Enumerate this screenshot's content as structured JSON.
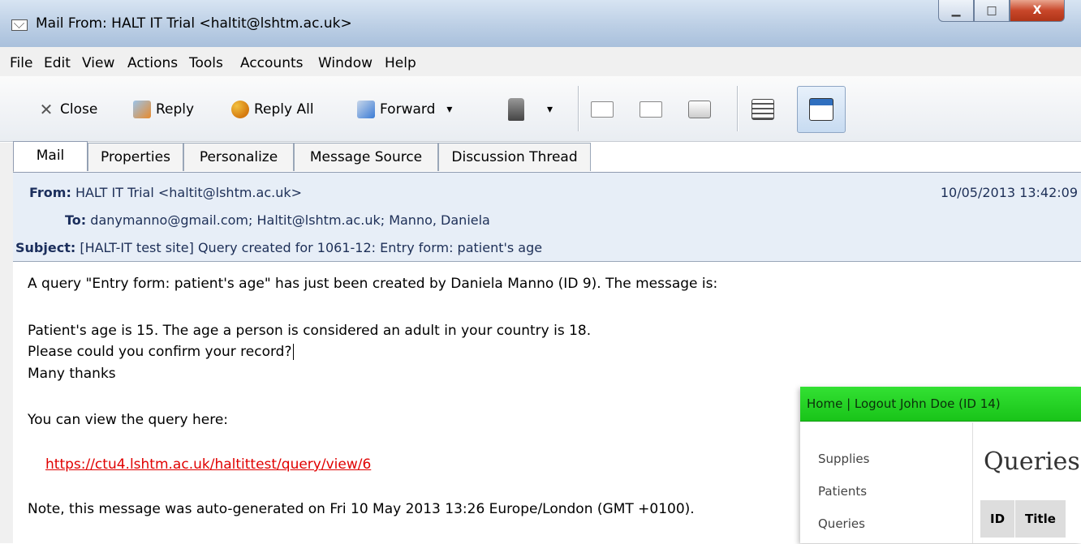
{
  "window": {
    "title": "Mail From: HALT IT Trial <haltit@lshtm.ac.uk>",
    "minimize": "▁",
    "maximize": "□",
    "close": "X"
  },
  "menu": [
    "File",
    "Edit",
    "View",
    "Actions",
    "Tools",
    "Accounts",
    "Window",
    "Help"
  ],
  "toolbar": {
    "close": "Close",
    "reply": "Reply",
    "reply_all": "Reply All",
    "forward": "Forward",
    "dropdown": "▾"
  },
  "tabs": [
    "Mail",
    "Properties",
    "Personalize",
    "Message Source",
    "Discussion Thread"
  ],
  "header": {
    "from_label": "From:",
    "from": "HALT IT Trial <haltit@lshtm.ac.uk>",
    "date": "10/05/2013 13:42:09",
    "to_label": "To:",
    "to": "danymanno@gmail.com; Haltit@lshtm.ac.uk; Manno, Daniela",
    "subject_label": "Subject:",
    "subject": "[HALT-IT test site] Query created for 1061-12: Entry form: patient's age"
  },
  "body": {
    "line1": "A query \"Entry form: patient's age\" has just been created by Daniela Manno (ID 9). The message is:",
    "line2": "Patient's age is 15. The age a person is considered an adult in your country is 18.",
    "line3": "Please could you confirm your record?",
    "line4": "Many thanks",
    "line5": "You can view the query here:",
    "link": "https://ctu4.lshtm.ac.uk/haltittest/query/view/6",
    "line6": "Note, this message was auto-generated on Fri 10 May 2013 13:26 Europe/London (GMT +0100)."
  },
  "web": {
    "nav": "Home | Logout John Doe (ID 14)",
    "side": [
      "Supplies",
      "Patients",
      "Queries"
    ],
    "page_title": "Queries",
    "columns": [
      "ID",
      "Title"
    ]
  }
}
